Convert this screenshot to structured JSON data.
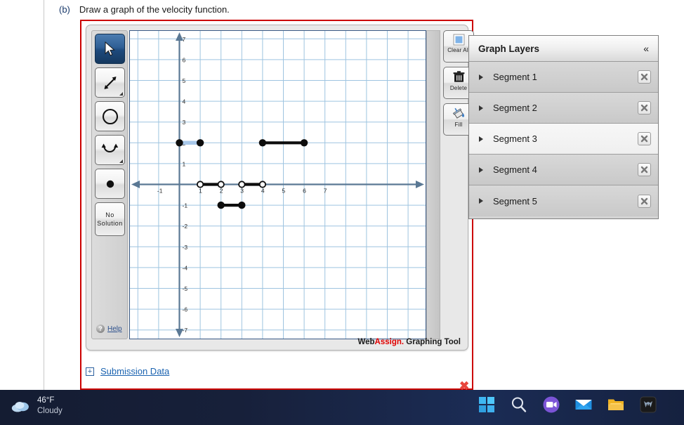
{
  "question": {
    "label": "(b)",
    "text": "Draw a graph of the velocity function."
  },
  "toolbar": {
    "tools": [
      {
        "name": "pointer-tool",
        "icon": "arrow-cursor",
        "selected": true,
        "has_corner": false
      },
      {
        "name": "segment-tool",
        "icon": "double-arrow-line",
        "selected": false,
        "has_corner": true
      },
      {
        "name": "circle-tool",
        "icon": "circle-outline",
        "selected": false,
        "has_corner": false
      },
      {
        "name": "curve-tool",
        "icon": "parabola-arrows",
        "selected": false,
        "has_corner": true
      },
      {
        "name": "point-tool",
        "icon": "filled-dot",
        "selected": false,
        "has_corner": false
      }
    ],
    "no_solution_line1": "No",
    "no_solution_line2": "Solution",
    "help_label": "Help",
    "help_icon": "question-mark-icon"
  },
  "commands": [
    {
      "name": "clear-all-button",
      "label": "Clear All",
      "icon": "blue-square-icon"
    },
    {
      "name": "delete-button",
      "label": "Delete",
      "icon": "trash-can-icon"
    },
    {
      "name": "fill-button",
      "label": "Fill",
      "icon": "paint-bucket-icon"
    }
  ],
  "watermark": {
    "part1": "Web",
    "part2": "Assign.",
    "part3": " Graphing Tool"
  },
  "layers_panel": {
    "title": "Graph Layers",
    "collapse_icon": "«",
    "close_icon": "✕",
    "items": [
      {
        "label": "Segment 1",
        "highlighted": false
      },
      {
        "label": "Segment 2",
        "highlighted": false
      },
      {
        "label": "Segment 3",
        "highlighted": true
      },
      {
        "label": "Segment 4",
        "highlighted": false
      },
      {
        "label": "Segment 5",
        "highlighted": false
      }
    ]
  },
  "submission": {
    "expand_icon": "+",
    "label": "Submission Data",
    "mark_icon": "red-x-icon"
  },
  "taskbar": {
    "weather": {
      "temp": "46°F",
      "condition": "Cloudy",
      "icon": "cloud-icon"
    },
    "icons": [
      {
        "name": "start-icon"
      },
      {
        "name": "search-icon"
      },
      {
        "name": "chat-icon"
      },
      {
        "name": "mail-icon"
      },
      {
        "name": "file-explorer-icon"
      },
      {
        "name": "predator-icon"
      }
    ]
  },
  "chart_data": {
    "type": "line",
    "title": "",
    "xlabel": "",
    "ylabel": "",
    "xlim": [
      -1.6,
      7.6
    ],
    "ylim": [
      -7.8,
      7.8
    ],
    "xticks": [
      -1,
      1,
      2,
      3,
      4,
      5,
      6,
      7
    ],
    "yticks": [
      7,
      6,
      5,
      4,
      3,
      2,
      1,
      -1,
      -2,
      -3,
      -4,
      -5,
      -6,
      -7
    ],
    "grid": true,
    "grid_color": "#9ec4e0",
    "axis_color": "#5a7894",
    "segments": [
      {
        "name": "Segment 1",
        "x0": 0,
        "y0": 2,
        "x1": 1,
        "y1": 2,
        "left_closed": true,
        "right_closed": true,
        "selected": true
      },
      {
        "name": "Segment 2",
        "x0": 1,
        "y0": 0,
        "x1": 2,
        "y1": 0,
        "left_closed": false,
        "right_closed": false,
        "selected": false
      },
      {
        "name": "Segment 3",
        "x0": 2,
        "y0": -1,
        "x1": 3,
        "y1": -1,
        "left_closed": true,
        "right_closed": true,
        "selected": false
      },
      {
        "name": "Segment 4",
        "x0": 3,
        "y0": 0,
        "x1": 4,
        "y1": 0,
        "left_closed": false,
        "right_closed": false,
        "selected": false
      },
      {
        "name": "Segment 5",
        "x0": 4,
        "y0": 2,
        "x1": 6,
        "y1": 2,
        "left_closed": true,
        "right_closed": true,
        "selected": false
      }
    ]
  }
}
